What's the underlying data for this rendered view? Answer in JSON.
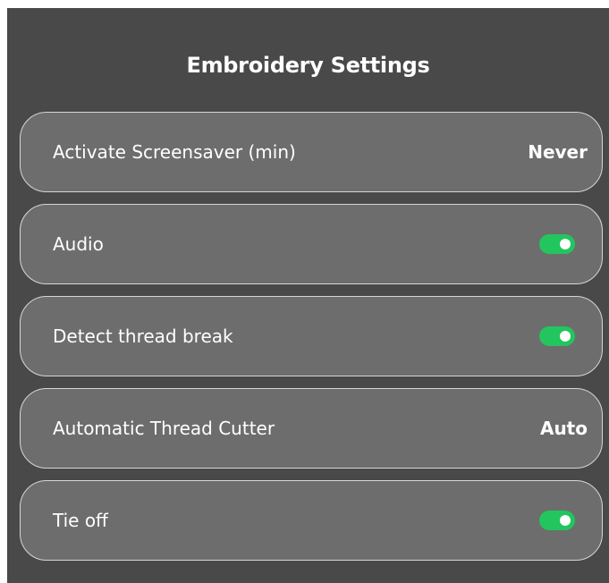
{
  "title": "Embroidery Settings",
  "settings": [
    {
      "label": "Activate Screensaver (min)",
      "type": "value",
      "value": "Never"
    },
    {
      "label": "Audio",
      "type": "toggle",
      "on": true
    },
    {
      "label": "Detect thread break",
      "type": "toggle",
      "on": true
    },
    {
      "label": "Automatic Thread Cutter",
      "type": "value",
      "value": "Auto"
    },
    {
      "label": "Tie off",
      "type": "toggle",
      "on": true
    }
  ],
  "colors": {
    "panel_bg": "#494949",
    "row_bg": "#6d6d6d",
    "row_border": "#d6d6d6",
    "toggle_on": "#22c55e"
  }
}
